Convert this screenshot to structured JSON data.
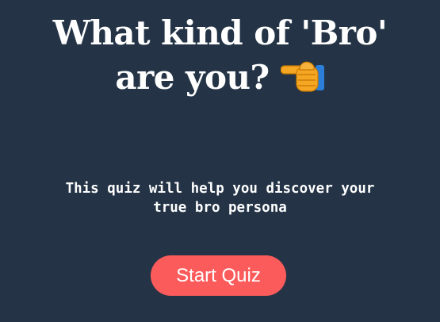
{
  "heading": {
    "line1": "What kind of 'Bro'",
    "line2": "are you?"
  },
  "icons": {
    "pointing_hand": "pointing-hand-icon"
  },
  "description": {
    "line1": "This quiz will help you discover your",
    "line2": "true bro persona"
  },
  "start_button": {
    "label": "Start Quiz"
  },
  "colors": {
    "background": "#243446",
    "text": "#ffffff",
    "button": "#fc5b5b"
  }
}
